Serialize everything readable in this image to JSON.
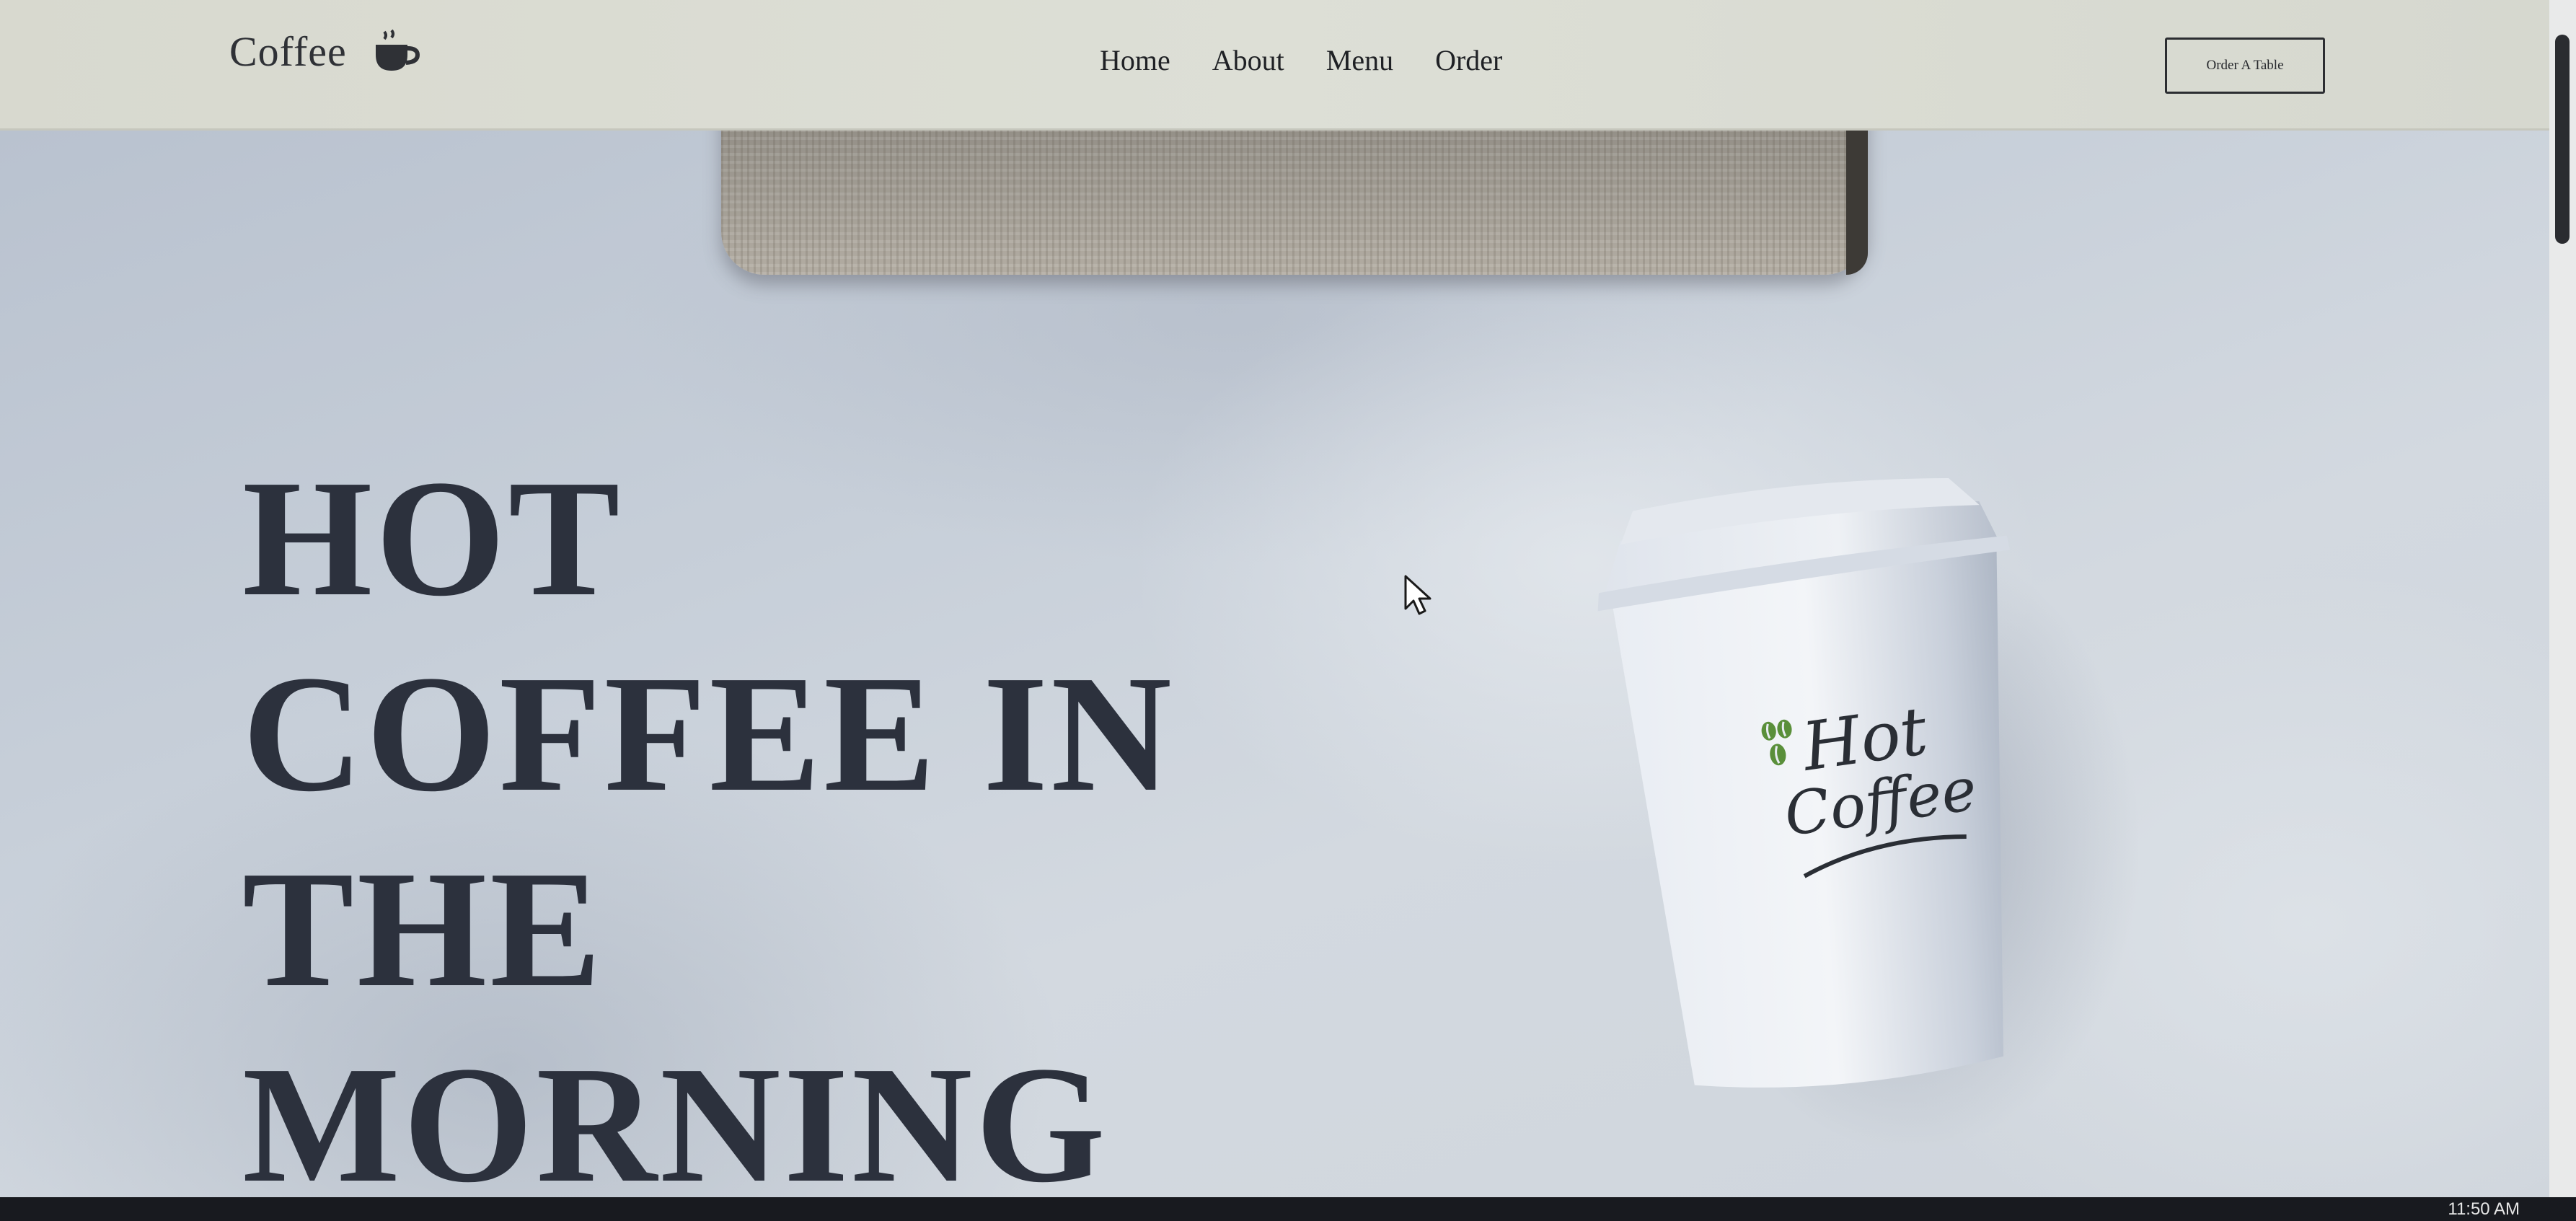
{
  "brand": {
    "name": "Coffee",
    "icon": "coffee-cup-icon"
  },
  "nav": {
    "links": [
      "Home",
      "About",
      "Menu",
      "Order"
    ],
    "cta_label": "Order A Table"
  },
  "hero": {
    "headline_lines": [
      "HOT",
      "COFFEE IN",
      "THE",
      "MORNING"
    ],
    "cup_logo_line1": "Hot",
    "cup_logo_line2": "Coffee"
  },
  "taskbar": {
    "clock": "11:50 AM"
  },
  "colors": {
    "headline": "#2c313d",
    "nav_text": "#1f2125",
    "logo_green": "#5a8f3a",
    "logo_ink": "#2a2e35"
  }
}
